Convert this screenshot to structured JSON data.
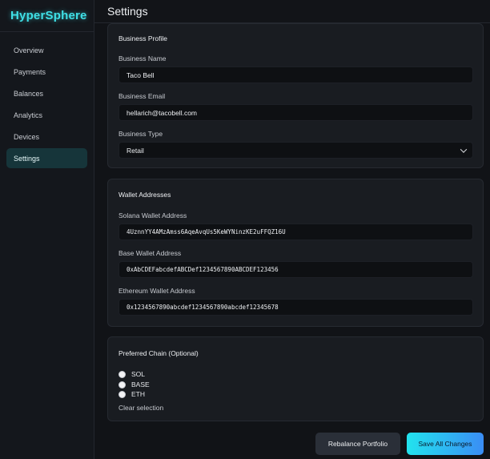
{
  "app": {
    "brand": "HyperSphere"
  },
  "sidebar": {
    "items": [
      {
        "label": "Overview",
        "active": false
      },
      {
        "label": "Payments",
        "active": false
      },
      {
        "label": "Balances",
        "active": false
      },
      {
        "label": "Analytics",
        "active": false
      },
      {
        "label": "Devices",
        "active": false
      },
      {
        "label": "Settings",
        "active": true
      }
    ]
  },
  "header": {
    "title": "Settings"
  },
  "business_profile": {
    "title": "Business Profile",
    "name_label": "Business Name",
    "name_value": "Taco Bell",
    "email_label": "Business Email",
    "email_value": "hellarich@tacobell.com",
    "type_label": "Business Type",
    "type_value": "Retail"
  },
  "wallets": {
    "title": "Wallet Addresses",
    "solana_label": "Solana Wallet Address",
    "solana_value": "4UznnYY4AMzAmss6AqeAvqUs5KeWYNinzKE2uFFQZ16U",
    "base_label": "Base Wallet Address",
    "base_value": "0xAbCDEFabcdefABCDef1234567890ABCDEF123456",
    "eth_label": "Ethereum Wallet Address",
    "eth_value": "0x1234567890abcdef1234567890abcdef12345678"
  },
  "chain": {
    "title": "Preferred Chain (Optional)",
    "options": [
      "SOL",
      "BASE",
      "ETH"
    ],
    "clear_label": "Clear selection"
  },
  "actions": {
    "rebalance_label": "Rebalance Portfolio",
    "save_label": "Save All Changes"
  },
  "colors": {
    "accent": "#3fe0e6",
    "background": "#111317",
    "card": "#191c21",
    "primary_gradient_start": "#22e3ee",
    "primary_gradient_end": "#3a8df5"
  }
}
